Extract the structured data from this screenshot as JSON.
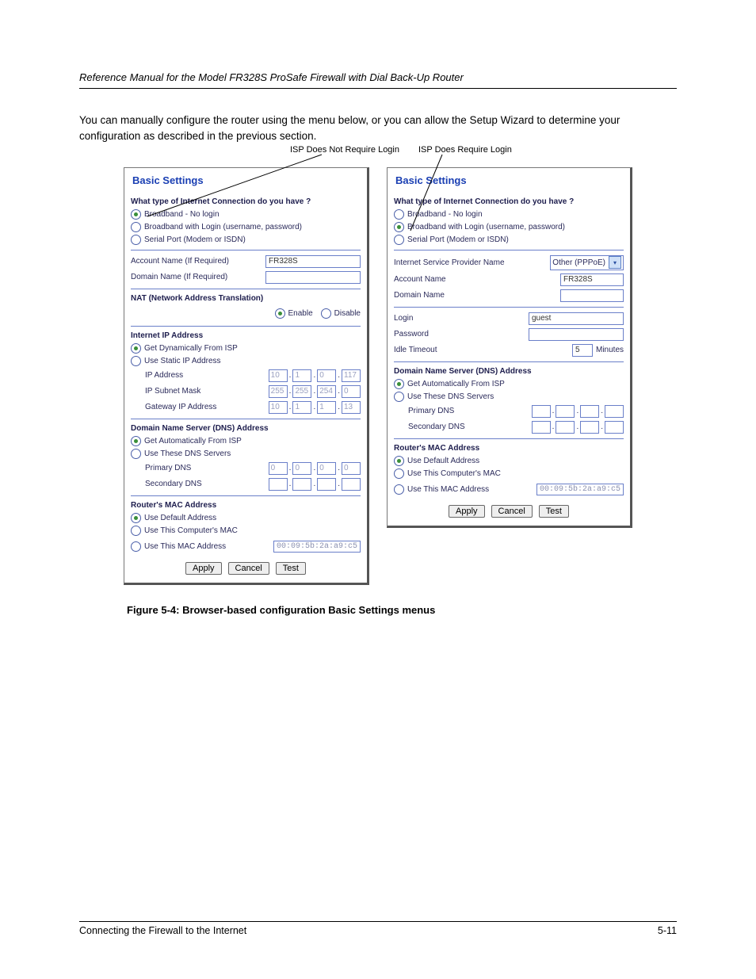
{
  "doc": {
    "running_head": "Reference Manual for the Model FR328S ProSafe Firewall with Dial Back-Up Router",
    "intro": "You can manually configure the router using the menu below, or you can allow the Setup Wizard to determine your configuration as described in the previous section.",
    "caption": "Figure 5-4:   Browser-based configuration Basic Settings menus",
    "footer_left": "Connecting the Firewall to the Internet",
    "footer_right": "5-11"
  },
  "callouts": {
    "left": "ISP Does Not Require Login",
    "right": "ISP Does Require Login"
  },
  "common": {
    "panel_title": "Basic Settings",
    "q": "What type of Internet Connection do you have ?",
    "opt_no_login": "Broadband - No login",
    "opt_login": "Broadband with Login (username, password)",
    "opt_serial": "Serial Port (Modem or ISDN)",
    "account_name": "Account Name  (If Required)",
    "domain_name": "Domain Name  (If Required)",
    "account_val": "FR328S",
    "dns_head": "Domain Name Server (DNS) Address",
    "dns_auto": "Get Automatically From ISP",
    "dns_use": "Use These DNS Servers",
    "primary_dns": "Primary DNS",
    "secondary_dns": "Secondary DNS",
    "mac_head": "Router's MAC Address",
    "mac_default": "Use Default Address",
    "mac_this_pc": "Use This Computer's MAC",
    "mac_use_addr": "Use This MAC Address",
    "mac_val": "00:09:5b:2a:a9:c5",
    "apply": "Apply",
    "cancel": "Cancel",
    "test": "Test"
  },
  "left": {
    "nat_head": "NAT (Network Address Translation)",
    "enable": "Enable",
    "disable": "Disable",
    "ip_head": "Internet IP Address",
    "ip_dyn": "Get Dynamically From ISP",
    "ip_static": "Use Static IP Address",
    "ip_addr": "IP Address",
    "subnet": "IP Subnet Mask",
    "gateway": "Gateway IP Address",
    "ip_vals": {
      "a": "10",
      "b": "1",
      "c": "0",
      "d": "117"
    },
    "mask_vals": {
      "a": "255",
      "b": "255",
      "c": "254",
      "d": "0"
    },
    "gw_vals": {
      "a": "10",
      "b": "1",
      "c": "1",
      "d": "13"
    },
    "pdns": {
      "a": "0",
      "b": "0",
      "c": "0",
      "d": "0"
    }
  },
  "right": {
    "isp_name_lbl": "Internet Service Provider Name",
    "isp_select": "Other (PPPoE)",
    "account_name_lbl": "Account Name",
    "domain_name_lbl": "Domain Name",
    "login_lbl": "Login",
    "login_val": "guest",
    "password_lbl": "Password",
    "idle_lbl": "Idle Timeout",
    "idle_val": "5",
    "idle_unit": "Minutes"
  }
}
